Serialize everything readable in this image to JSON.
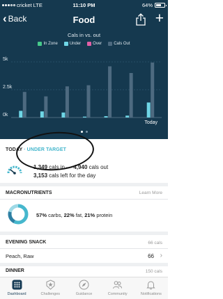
{
  "status_bar": {
    "carrier": "cricket",
    "network": "LTE",
    "time": "11:10 PM",
    "battery": "64%",
    "battery_level": 0.64
  },
  "header": {
    "back_label": "Back",
    "title": "Food"
  },
  "chart_section": {
    "chart_title": "Cals in vs. out",
    "legend": [
      {
        "label": "In Zone",
        "color": "#46c98a"
      },
      {
        "label": "Under",
        "color": "#6fd6e6"
      },
      {
        "label": "Over",
        "color": "#e05fa6"
      },
      {
        "label": "Cals Out",
        "color": "#4d6a80"
      }
    ],
    "pager": {
      "count": 2,
      "active": 0
    }
  },
  "chart_data": {
    "type": "bar",
    "categories": [
      "",
      "",
      "",
      "",
      "",
      "",
      "Today"
    ],
    "series": [
      {
        "name": "Under",
        "color": "#6fd6e6",
        "values": [
          600,
          550,
          450,
          80,
          120,
          170,
          1350
        ]
      },
      {
        "name": "Cals Out",
        "color": "#4d6a80",
        "values": [
          2300,
          1900,
          2800,
          2900,
          4600,
          4000,
          4940
        ]
      }
    ],
    "yticks": [
      "0k",
      "2.5k",
      "5k"
    ],
    "ylim": [
      0,
      5000
    ],
    "grid": true
  },
  "today": {
    "label": "TODAY",
    "separator": "·",
    "status": "UNDER TARGET",
    "cals_in": "1,349",
    "cals_in_suffix": " cals in — ",
    "cals_out": "4,940",
    "cals_out_suffix": " cals out",
    "cals_left": "3,153",
    "cals_left_suffix": " cals left for the day"
  },
  "macros": {
    "title": "MACRONUTRIENTS",
    "learn_more": "Learn More",
    "carbs_pct": "57%",
    "carbs_label": " carbs, ",
    "fat_pct": "22%",
    "fat_label": " fat, ",
    "protein_pct": "21%",
    "protein_label": " protein",
    "ring": [
      {
        "name": "carbs",
        "value": 57,
        "color": "#46b7cd"
      },
      {
        "name": "fat",
        "value": 22,
        "color": "#2d7fa3"
      },
      {
        "name": "protein",
        "value": 21,
        "color": "#9ed9e6"
      }
    ]
  },
  "meals": [
    {
      "title": "EVENING SNACK",
      "cals": "66 cals",
      "items": [
        {
          "name": "Peach, Raw",
          "cals": "66"
        }
      ]
    },
    {
      "title": "DINNER",
      "cals": "150 cals",
      "items": []
    }
  ],
  "tabs": [
    {
      "label": "Dashboard",
      "icon": "dashboard-icon"
    },
    {
      "label": "Challenges",
      "icon": "star-badge-icon"
    },
    {
      "label": "Guidance",
      "icon": "compass-icon"
    },
    {
      "label": "Community",
      "icon": "people-icon"
    },
    {
      "label": "Notifications",
      "icon": "bell-icon"
    }
  ],
  "active_tab": 0,
  "colors": {
    "header_bg": "#15394f",
    "accent": "#46b7cd"
  }
}
